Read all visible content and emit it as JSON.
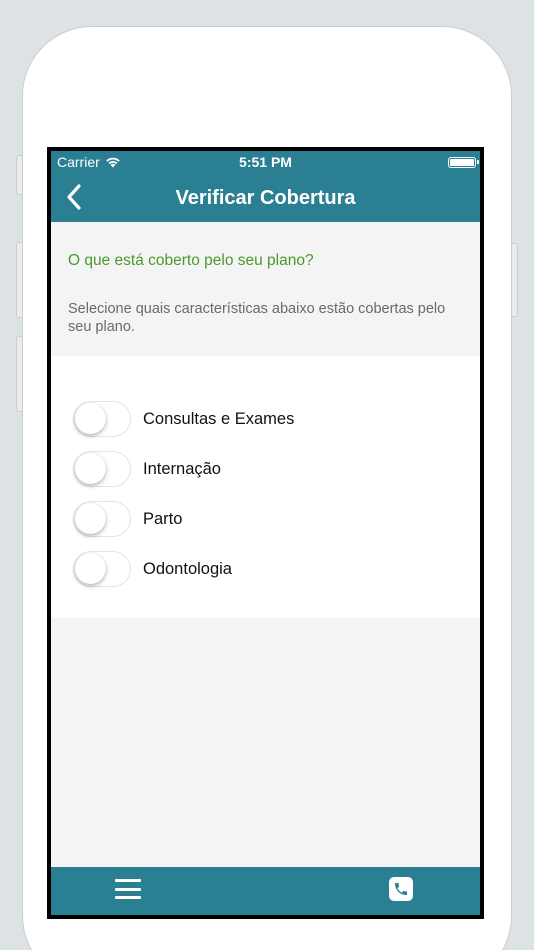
{
  "status_bar": {
    "carrier": "Carrier",
    "time": "5:51 PM"
  },
  "nav": {
    "back_icon": "chevron-left-icon",
    "title": "Verificar Cobertura"
  },
  "intro": {
    "title": "O que está coberto pelo seu plano?",
    "description": "Selecione quais características abaixo estão cobertas pelo seu plano."
  },
  "options": [
    {
      "label": "Consultas e Exames",
      "enabled": false
    },
    {
      "label": "Internação",
      "enabled": false
    },
    {
      "label": "Parto",
      "enabled": false
    },
    {
      "label": "Odontologia",
      "enabled": false
    }
  ],
  "tab_bar": {
    "menu_icon": "hamburger-menu-icon",
    "phone_icon": "phone-icon"
  },
  "colors": {
    "primary": "#2b7f93",
    "accent_green": "#4a9a2e",
    "background": "#f4f4f4"
  }
}
